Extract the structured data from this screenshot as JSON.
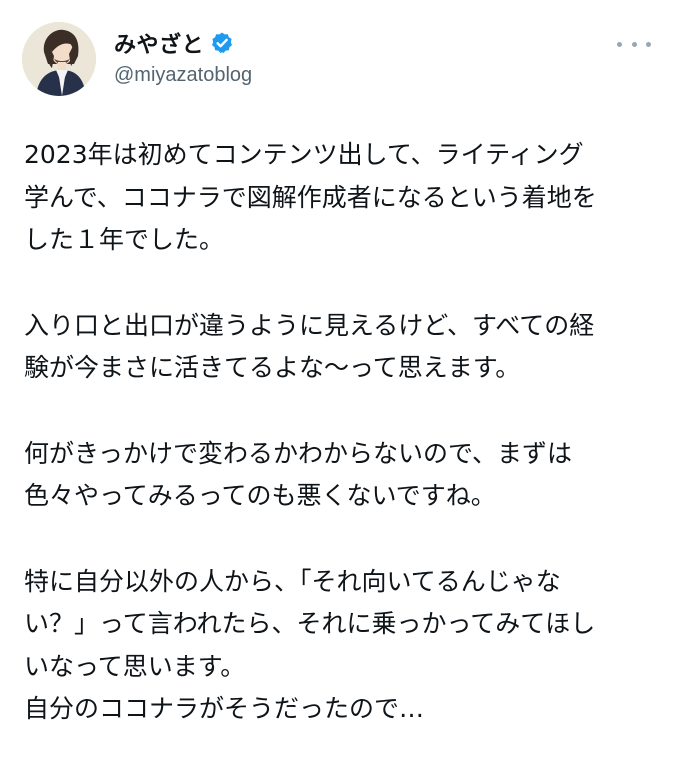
{
  "author": {
    "display_name": "みやざと",
    "handle": "@miyazatoblog",
    "verified_icon": "verified-badge-icon",
    "verified_color": "#1d9bf0"
  },
  "more_icon": "more-horizontal-icon",
  "tweet": {
    "paragraphs": [
      [
        "2023年は初めてコンテンツ出して、ライティング",
        "学んで、ココナラで図解作成者になるという着地を",
        "した１年でした。"
      ],
      [
        "入り口と出口が違うように見えるけど、すべての経",
        "験が今まさに活きてるよな〜って思えます。"
      ],
      [
        "何がきっかけで変わるかわからないので、まずは",
        "色々やってみるってのも悪くないですね。"
      ],
      [
        "特に自分以外の人から、「それ向いてるんじゃな",
        "い？」って言われたら、それに乗っかってみてほし",
        "いなって思います。",
        "自分のココナラがそうだったので…"
      ]
    ]
  }
}
